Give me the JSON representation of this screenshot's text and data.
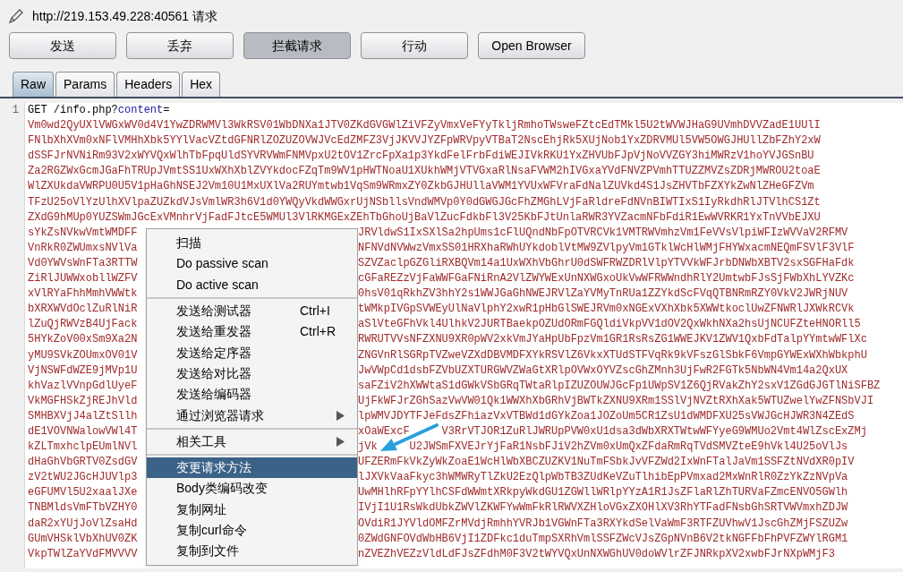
{
  "title": "http://219.153.49.228:40561 请求",
  "buttons": [
    {
      "label": "发送",
      "selected": false
    },
    {
      "label": "丢弃",
      "selected": false
    },
    {
      "label": "拦截请求",
      "selected": true
    },
    {
      "label": "行动",
      "selected": false
    },
    {
      "label": "Open Browser",
      "selected": false
    }
  ],
  "tabs": [
    {
      "label": "Raw",
      "selected": true
    },
    {
      "label": "Params",
      "selected": false
    },
    {
      "label": "Headers",
      "selected": false
    },
    {
      "label": "Hex",
      "selected": false
    }
  ],
  "editor": {
    "line_number": "1",
    "request_line": [
      {
        "kind": "plain",
        "text": "GET /info.php?"
      },
      {
        "kind": "param",
        "text": "content"
      },
      {
        "kind": "plain",
        "text": "="
      }
    ],
    "rows": [
      {
        "kind": "full",
        "text": "Vm0wd2QyUXlVWGxWV0d4V1YwZDRWMVl3WkRSV01WbDNXa1JTV0ZKdGVGWlZiVFZyVmxVeFYyTkljRmhoTWsweFZtcEdTMkl5U2tWVWJHaG9UVmhDVVZadE1UUlI"
      },
      {
        "kind": "full",
        "text": "FNlbXhXVm0xNFlVMHhXbk5YYlVacVZtdGFNRlZOZUZOVWJVcEdZMFZ3VjJKVVJYZFpWRVpyVTBaT2NscEhjRk5XUjNob1YxZDRVMUl5VW5OWGJHUllZbFZhY2xW"
      },
      {
        "kind": "full",
        "text": "dSSFJrNVNiRm93V2xWYVQxWlhTbFpqUldSYVRVWmFNMVpxU2tOV1ZrcFpXa1p3YkdFelFrbFdiWEJIVkRKU1YxZHVUbFJpVjNoVVZGY3hiMWRzV1hoYVJGSnBU"
      },
      {
        "kind": "full",
        "text": "Za2RGZWxGcmJGaFhTRUpJVmtSS1UxWXhXblZVYkdocFZqTm9WV1pHWTNoaU1XUkhWMjVTVGxaRlNsaFVWM2hIVGxaYVdFNVZPVmhTTUZZMVZsZDRjMWROU2toaE"
      },
      {
        "kind": "full",
        "text": "WlZXUkdaVWRPU0U5V1pHaGhNSEJ2Vm10U1MxUXlVa2RUYmtwb1VqSm9WRmxZY0ZkbGJHUllaVWM1YVUxWFVraFdNalZUVkd4S1JsZHVTbFZXYkZwNlZHeGFZVm"
      },
      {
        "kind": "full",
        "text": "TFzU25oVlYzUlhXVlpaZUZkdVJsVmlWR3h6V1d0YWQyVkdWWGxrUjNSbllsVndWMVp0Y0dGWGJGcFhZMGhLVjFaRldreFdNVnBIWTIxS1IyRkdhRlJTVlhCS1Zt"
      },
      {
        "kind": "full",
        "text": "ZXdG9hMUp0YUZSWmJGcExVMnhrVjFadFJtcE5WMUl3VlRKMGExZEhTbGhoUjBaVlZucFdkbFl3V25KbFJtUnlaRWR3YVZacmNFbFdiR1EwWVRKR1YxTnVVbEJXU"
      },
      {
        "kind": "split",
        "left": "sYkZsNVkwVmtWMDFF",
        "right": "JRVldwS1IxSXlSa2hpUms1cFlUQndNbFpOTVRCVk1VMTRWVmhzVm1FeVVsVlpiWFIzWVVaV2RFMV"
      },
      {
        "kind": "split",
        "left": "VnRkR0ZWUmxsNVlVa",
        "right": "NFNVdNVWwzVmxSS01HRXhaRWhUYkdoblVtMW9ZVlpyVm1GTklWcHlWMjFHYWxacmNEQmFSVlF3VlF"
      },
      {
        "kind": "split",
        "left": "Vd0YWVsWnFTa3RTTW",
        "right": "SZVZaclpGZGliRXBQVm14a1UxWXhVbGhrU0dSWFRWZDRlVlpYTVVkWFJrbDNWbXBTV2sxSGFHaFdk"
      },
      {
        "kind": "split",
        "left": "ZiRlJUWWxobllWZFV",
        "right": "cGFaREZzVjFaWWFGaFNiRnA2VlZWYWExUnNXWGxoUkVwWFRWWndhRlY2UmtwbFJsSjFWbXhLYVZKc"
      },
      {
        "kind": "split",
        "left": "xVlRYaFhhMmhVWWtk",
        "right": "0hsV01qRkhZV3hhY2s1WWJGaGhNWEJRVlZaYVMyTnRUa1ZZYkdScFVqQTBNRmRZY0VkV2JWRjNUV"
      },
      {
        "kind": "split",
        "left": "bXRXWVdOclZuRlNiR",
        "right": "tWMkpIVGpSVWEyUlNaVlphY2xwR1pHbGlSWEJRVm0xNGExVXhXbk5XWWtkoclUwZFNWRlJXWkRCVk"
      },
      {
        "kind": "split",
        "left": "lZuQjRWVzB4UjFack",
        "right": "aSlVteGFhVkl4UlhkV2JURTBaekpOZUdORmFGQldiVkpVV1dOV2QxWkhNXa2hsUjNCUFZteHNORll5"
      },
      {
        "kind": "split",
        "left": "5HYkZoV00xSm9Xa2N",
        "right": "RWRUTVVsNFZXNU9XR0pWV2xkVmJYaHpUbFpzVm1GR1RsRsZG1WWEJKV1ZWV1QxbFdTalpYYmtwWFlXc"
      },
      {
        "kind": "split",
        "left": "yMU9SVkZOUmxOV01V",
        "right": "ZNGVnRlSGRpTVZweVZXdDBVMDFXYkRSVlZ6VkxXTUdSTFVqRk9kVFszGlSbkF6VmpGYWExWXhWbkphU"
      },
      {
        "kind": "split",
        "left": "VjNSWFdWZE9jMVp1U",
        "right": "JwVWpCd1dsbFZVbUZXTURGWVZWaGtXRlpOVWxOYVZscGhZMnh3UjFwR2FGTk5NbWN4Vm14a2QxUX"
      },
      {
        "kind": "split",
        "left": "khVazlVVnpGdlUyeF",
        "right": "saFZiV2hXWWtaS1dGWkVSbGRqTWtaRlpIZUZOUWJGcFp1UWpSV1Z6QjRVakZhY2sxV1ZGdGJGTlNiSFBZ"
      },
      {
        "kind": "split",
        "left": "VkMGFHSkZjREJhVld",
        "right": "UjFkWFJrZGhSazVwVW01Qk1WWXhXbGRhVjBWTkZXNU9XRm1SSlVjNVZtRXhXak5WTUZwelYwZFNSbVJI"
      },
      {
        "kind": "split",
        "left": "SMHBXVjJ4alZtSllh",
        "right": "lpWMVJDYTFJeFdsZFhiazVxVTBWd1dGYkZoa1JOZoUm5CR1ZsU1dWMDFXU25sVWJGcHJWR3N4ZEdS"
      },
      {
        "kind": "split3",
        "left": "dE1VOVNWalowVWl4T",
        "mid": "xOaWExcF",
        "right": "V3RrVTJOR1ZuRlJWRUpPVW0xU1dsa3dWbXRXTWtwWFYyeG9WMUo2Vmt4WlZscExZMj"
      },
      {
        "kind": "split3",
        "left": "kZLTmxhclpEUmlNVl",
        "mid": "jVk",
        "right": "U2JWSmFXVEJrYjFaR1NsbFJiV2hZVm0xUmQxZFdaRmRqTVdSMVZteE9hVkl4U25oVlJs"
      },
      {
        "kind": "split",
        "left": "dHaGhVbGRTV0ZsdGV",
        "right": "UFZERmFkVkZyWkZoaE1WcHlWbXBCZUZKV1NuTmFSbkJvVFZWd2IxWnFTalJaVm1SSFZtNVdXR0pIV"
      },
      {
        "kind": "split",
        "left": "zV2tWU2JGcHJUVlp3",
        "right": "lJXVkVaaFkyc3hWMWRyTlZkU2EzQlpWbTB3ZUdKeVZuTlhibEpPVmxad2MxWnRlR0ZzYkZzNVpVa"
      },
      {
        "kind": "split",
        "left": "eGFUMVl5U2xaalJXe",
        "right": "UwMHlhRFpYYlhCSFdWWmtXRkpyWkdGU1ZGWllWRlpYYzA1R1JsZFlaRlZhTURVaFZmcENVO5GWlh"
      },
      {
        "kind": "split",
        "left": "TNBMldsVmFTbVZHY0",
        "right": "IVjI1U1RsWkdUbkZWVlZKWFYwWmFkRlRWVXZHloVGxZXOHlXV3RhYTFadFNsbGhSRTVWVmxhZDJW"
      },
      {
        "kind": "split",
        "left": "daR2xYUjJoVlZsaHd",
        "right": "OVdiR1JYVldOMFZrMVdjRmhhYVRJb1VGWnFTa3RXYkdSelVaWmF3RTFZUVhwV1JscGhZMjFSZUZw"
      },
      {
        "kind": "split",
        "left": "GUmVHSklVbXhUV0ZK",
        "right": "0ZWdGNFOVdWbHB6VjI1ZDFkc1duTmpSXRhVmlSSFZWcVJsZGpNVnB6V2tkNGFFbFhPVFZWYlRGM1"
      },
      {
        "kind": "split",
        "left": "VkpTWlZaYVdFMVVVV",
        "right": "nZVEZhVEZzVldLdFJsZFdhM0F3V2tWYVQxUnNXWGhUV0doWVlrZFJNRkpXV2xwbFJrNXpWMjF3"
      }
    ]
  },
  "context_menu": {
    "items": [
      {
        "kind": "item",
        "label": "扫描",
        "selected": false
      },
      {
        "kind": "item",
        "label": "Do passive scan",
        "selected": false
      },
      {
        "kind": "item",
        "label": "Do active scan",
        "selected": false
      },
      {
        "kind": "separator"
      },
      {
        "kind": "item",
        "label": "发送给测试器",
        "shortcut": "Ctrl+I",
        "selected": false
      },
      {
        "kind": "item",
        "label": "发送给重发器",
        "shortcut": "Ctrl+R",
        "selected": false
      },
      {
        "kind": "item",
        "label": "发送给定序器",
        "selected": false
      },
      {
        "kind": "item",
        "label": "发送给对比器",
        "selected": false
      },
      {
        "kind": "item",
        "label": "发送给编码器",
        "selected": false
      },
      {
        "kind": "item",
        "label": "通过浏览器请求",
        "submenu": true,
        "selected": false
      },
      {
        "kind": "separator"
      },
      {
        "kind": "item",
        "label": "相关工具",
        "submenu": true,
        "selected": false
      },
      {
        "kind": "separator"
      },
      {
        "kind": "item",
        "label": "变更请求方法",
        "selected": true
      },
      {
        "kind": "item",
        "label": "Body类编码改变",
        "selected": false
      },
      {
        "kind": "item",
        "label": "复制网址",
        "selected": false
      },
      {
        "kind": "item",
        "label": "复制curl命令",
        "selected": false
      },
      {
        "kind": "item",
        "label": "复制到文件",
        "selected": false
      }
    ]
  }
}
